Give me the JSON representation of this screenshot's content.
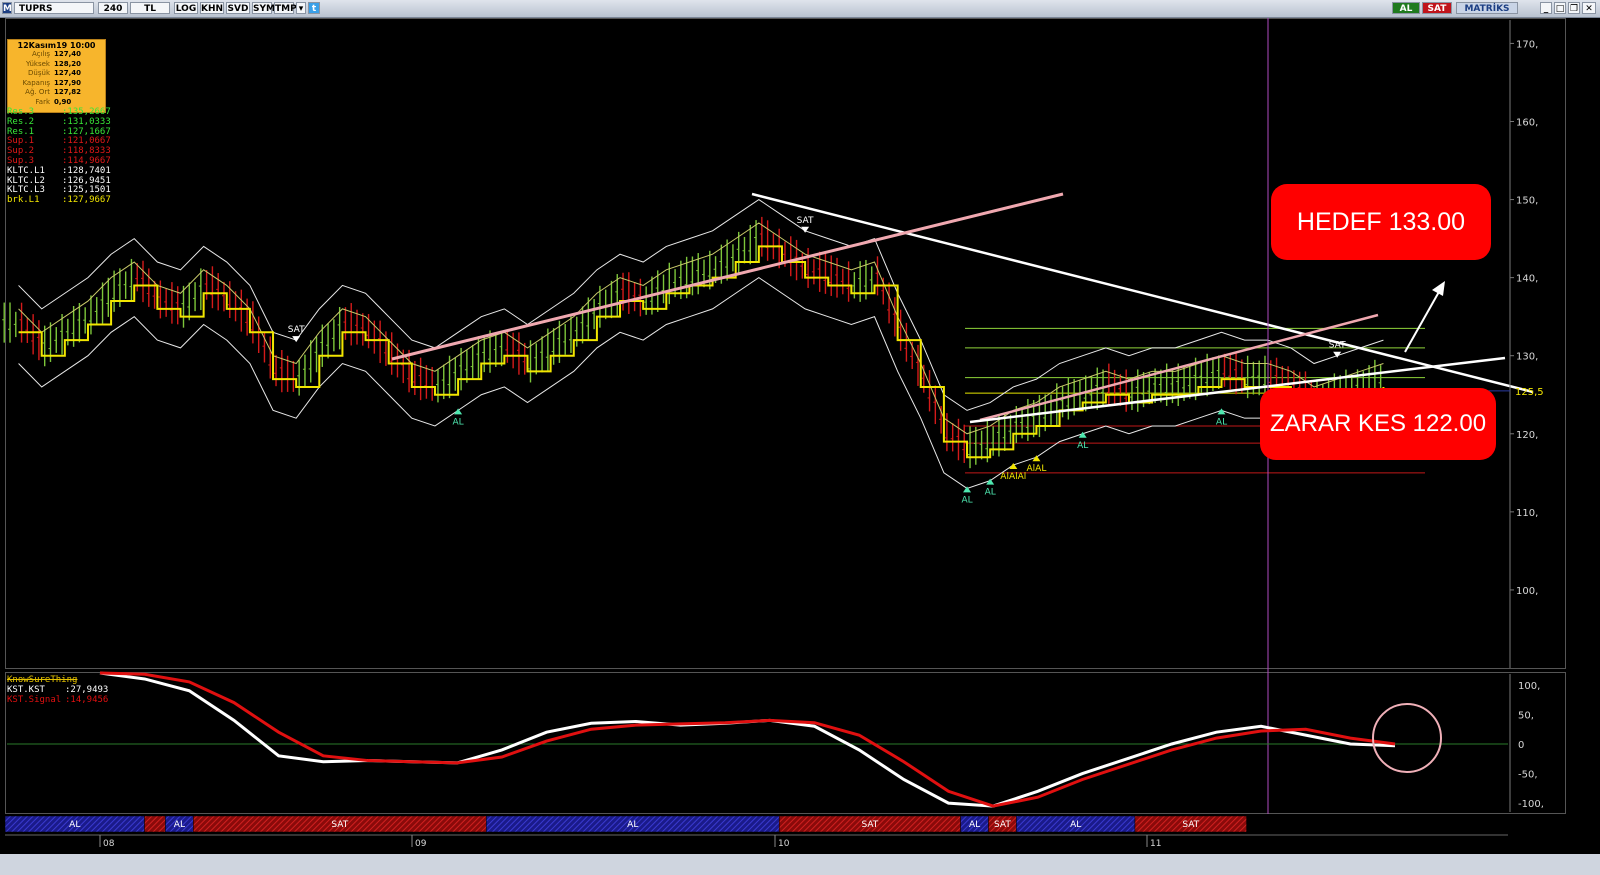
{
  "toolbar": {
    "symbol": "TUPRS",
    "period": "240",
    "currency": "TL",
    "buttons": [
      "LOG",
      "KHN",
      "SVD",
      "SYM",
      "TMP"
    ],
    "al": "AL",
    "sat": "SAT",
    "brand": "MATRİKS"
  },
  "infobox": {
    "title": "12Kasım19 10:00",
    "rows": [
      {
        "k": "Açılış",
        "v": "127,40"
      },
      {
        "k": "Yüksek",
        "v": "128,20"
      },
      {
        "k": "Düşük",
        "v": "127,40"
      },
      {
        "k": "Kapanış",
        "v": "127,90"
      },
      {
        "k": "Ağ. Ort",
        "v": "127,82"
      },
      {
        "k": "Fark",
        "v": "0,90"
      }
    ]
  },
  "levels": [
    {
      "k": "Res.3",
      "v": ":135,2667",
      "color": "#38e638"
    },
    {
      "k": "Res.2",
      "v": ":131,0333",
      "color": "#38e638"
    },
    {
      "k": "Res.1",
      "v": ":127,1667",
      "color": "#38e638"
    },
    {
      "k": "Sup.1",
      "v": ":121,0667",
      "color": "#e01818"
    },
    {
      "k": "Sup.2",
      "v": ":118,8333",
      "color": "#e01818"
    },
    {
      "k": "Sup.3",
      "v": ":114,9667",
      "color": "#e01818"
    },
    {
      "k": "KLTC.L1",
      "v": ":128,7401",
      "color": "#ffffff"
    },
    {
      "k": "KLTC.L2",
      "v": ":126,9451",
      "color": "#ffffff"
    },
    {
      "k": "KLTC.L3",
      "v": ":125,1501",
      "color": "#ffffff"
    },
    {
      "k": "brk.L1",
      "v": ":127,9667",
      "color": "#f2e600"
    }
  ],
  "callouts": {
    "target": "HEDEF 133.00",
    "stop": "ZARAR KES 122.00"
  },
  "indicator": {
    "name": "KnowSureThing",
    "kst": {
      "k": "KST.KST",
      "v": ":27,9493"
    },
    "signal": {
      "k": "KST.Signal",
      "v": ":14,9456"
    }
  },
  "chart_data": [
    {
      "type": "candlestick",
      "title": "",
      "xlabel": "",
      "ylabel": "",
      "ylim": [
        90,
        173
      ],
      "ticks_y": [
        "170,",
        "160,",
        "150,",
        "140,",
        "130,",
        "120,",
        "110,",
        "100,"
      ],
      "tick_values_y": [
        170,
        160,
        150,
        140,
        130,
        120,
        110,
        100
      ],
      "x_labels": [
        "08",
        "09",
        "10",
        "11"
      ],
      "last_price_label": "125,5",
      "last_price": 125.5,
      "price_path": [
        134,
        131,
        133,
        135,
        138,
        140,
        137,
        136,
        139,
        137,
        134,
        128,
        127,
        131,
        134,
        133,
        130,
        127,
        126,
        128,
        130,
        131,
        129,
        131,
        133,
        136,
        138,
        137,
        139,
        140,
        141,
        143,
        145,
        143,
        141,
        140,
        139,
        140,
        133,
        127,
        120,
        118,
        119,
        121,
        122,
        124,
        125,
        126,
        125,
        126,
        126,
        127,
        128,
        127,
        127,
        126,
        124,
        125,
        126,
        127
      ],
      "signals": [
        {
          "label": "SAT",
          "i": 12
        },
        {
          "label": "AL",
          "i": 19
        },
        {
          "label": "SAT",
          "i": 34
        },
        {
          "label": "AL",
          "i": 41
        },
        {
          "label": "AL",
          "i": 42
        },
        {
          "label": "AlAlAl",
          "i": 43
        },
        {
          "label": "AlAL",
          "i": 44
        },
        {
          "label": "AL",
          "i": 46
        },
        {
          "label": "AL",
          "i": 52
        },
        {
          "label": "SAT",
          "i": 57
        }
      ],
      "horizontal_levels": [
        {
          "value": 133.5,
          "color": "#8fd43a"
        },
        {
          "value": 131.0,
          "color": "#8fd43a"
        },
        {
          "value": 127.2,
          "color": "#8fd43a"
        },
        {
          "value": 125.2,
          "color": "#e6e600"
        },
        {
          "value": 121.0,
          "color": "#c01818"
        },
        {
          "value": 118.8,
          "color": "#c01818"
        },
        {
          "value": 115.0,
          "color": "#c01818"
        }
      ]
    },
    {
      "type": "line",
      "name_printed": "KnowSureThing",
      "ylim": [
        -115,
        115
      ],
      "ticks_y": [
        "100,",
        "50,",
        "0",
        "-50,",
        "-100,"
      ],
      "tick_values_y": [
        100,
        50,
        0,
        -50,
        -100
      ],
      "series": [
        {
          "name": "KST.KST",
          "color": "#ffffff",
          "values": [
            120,
            110,
            90,
            40,
            -20,
            -30,
            -28,
            -30,
            -32,
            -10,
            20,
            35,
            38,
            32,
            35,
            40,
            30,
            -10,
            -60,
            -100,
            -105,
            -80,
            -50,
            -25,
            0,
            20,
            30,
            15,
            0,
            -3
          ]
        },
        {
          "name": "KST.Signal",
          "color": "#e01010",
          "values": [
            120,
            118,
            105,
            70,
            20,
            -20,
            -28,
            -30,
            -32,
            -22,
            5,
            25,
            32,
            34,
            36,
            40,
            36,
            15,
            -30,
            -80,
            -105,
            -90,
            -60,
            -35,
            -10,
            10,
            22,
            25,
            10,
            0
          ]
        }
      ]
    },
    {
      "type": "signal_strip",
      "segments": [
        {
          "label": "AL",
          "color": "blue",
          "from": 0,
          "to": 0.1
        },
        {
          "label": "",
          "color": "red",
          "from": 0.1,
          "to": 0.115
        },
        {
          "label": "AL",
          "color": "blue",
          "from": 0.115,
          "to": 0.135
        },
        {
          "label": "SAT",
          "color": "red",
          "from": 0.135,
          "to": 0.345
        },
        {
          "label": "AL",
          "color": "blue",
          "from": 0.345,
          "to": 0.555
        },
        {
          "label": "SAT",
          "color": "red",
          "from": 0.555,
          "to": 0.685
        },
        {
          "label": "AL",
          "color": "blue",
          "from": 0.685,
          "to": 0.705
        },
        {
          "label": "SAT",
          "color": "red",
          "from": 0.705,
          "to": 0.725
        },
        {
          "label": "AL",
          "color": "blue",
          "from": 0.725,
          "to": 0.81
        },
        {
          "label": "SAT",
          "color": "red",
          "from": 0.81,
          "to": 0.89
        }
      ]
    }
  ]
}
